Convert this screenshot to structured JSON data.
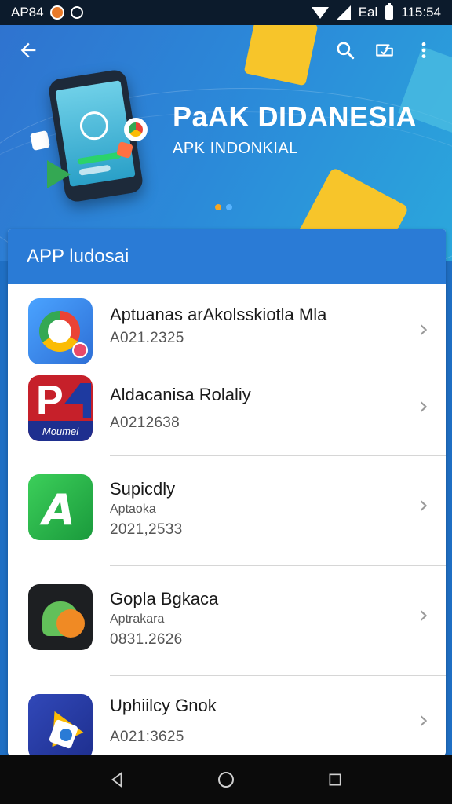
{
  "status_bar": {
    "carrier": "AP84",
    "time": "115:54",
    "network_label": "Eal"
  },
  "banner": {
    "title": "PaAK DIDANESIA",
    "subtitle": "APK INDONKIAL"
  },
  "list": {
    "header": "APP ludosai",
    "items": [
      {
        "name": "Aptuanas arAkolsskiotla Mla",
        "category": "",
        "version": "A021.2325",
        "icon": "chrome-icon"
      },
      {
        "name": "Aldacanisa Rolaliy",
        "category": "",
        "version": "A0212638",
        "icon": "p4-moumei-icon",
        "icon_text": "Moumei"
      },
      {
        "name": "Supicdly",
        "category": "Aptaoka",
        "version": "2021,2533",
        "icon": "green-a-icon"
      },
      {
        "name": "Gopla Bgkaca",
        "category": "Aptrakara",
        "version": "0831.2626",
        "icon": "android-icon"
      },
      {
        "name": "Uphiilcy Gnok",
        "category": "",
        "version": "A021:3625",
        "icon": "drive-icon"
      }
    ]
  },
  "colors": {
    "banner_start": "#2f73cf",
    "header_blue": "#2a7bd6",
    "accent_yellow": "#f7c52a"
  }
}
